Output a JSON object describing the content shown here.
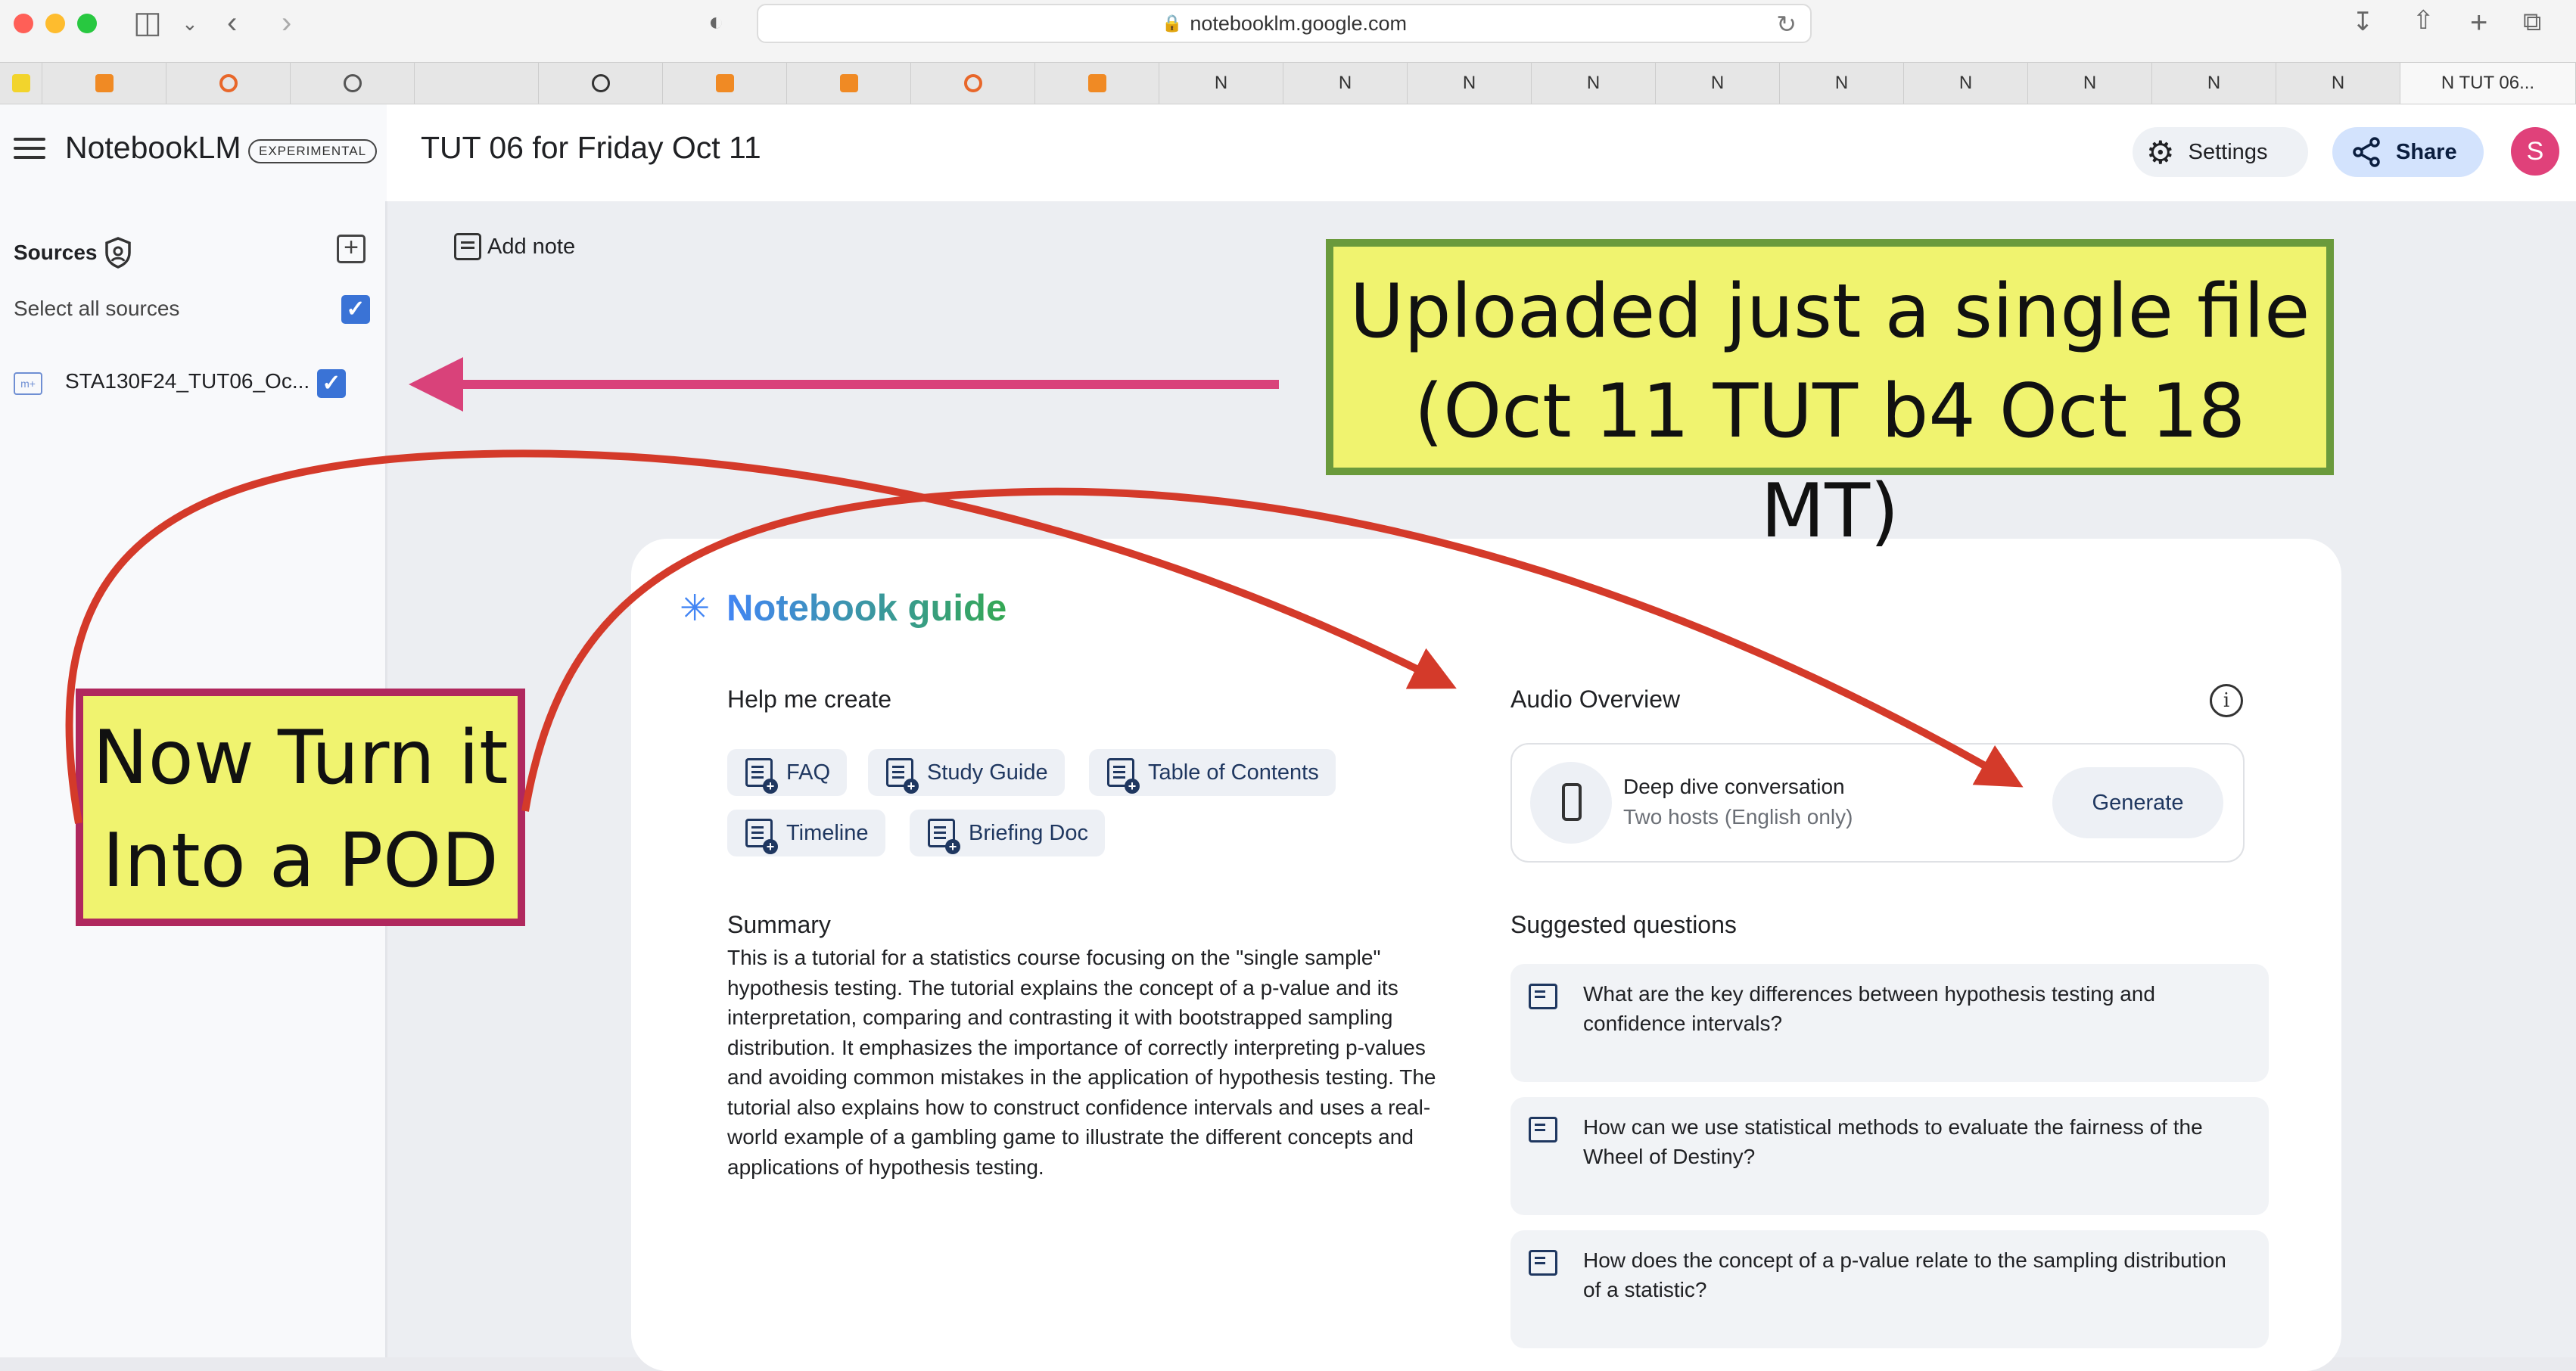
{
  "browser": {
    "url": "notebooklm.google.com",
    "tabs": [
      "",
      "",
      "",
      "",
      "",
      "",
      "",
      "",
      "",
      "N",
      "N",
      "N",
      "N",
      "N",
      "N",
      "N",
      "N",
      "N",
      "N",
      "N  TUT 06..."
    ],
    "active_tab_label": "N  TUT 06..."
  },
  "app": {
    "name": "NotebookLM",
    "badge": "EXPERIMENTAL",
    "notebook_title": "TUT 06 for Friday Oct 11",
    "settings_label": "Settings",
    "share_label": "Share",
    "avatar_initial": "S",
    "avatar_color": "#e0417a"
  },
  "sidebar": {
    "sources_label": "Sources",
    "select_all_label": "Select all sources",
    "sources": [
      {
        "label": "STA130F24_TUT06_Oc...",
        "checked": true
      }
    ]
  },
  "main": {
    "add_note_label": "Add note"
  },
  "guide": {
    "title": "Notebook guide",
    "help_heading": "Help me create",
    "chips": [
      "FAQ",
      "Study Guide",
      "Table of Contents",
      "Timeline",
      "Briefing Doc"
    ],
    "summary_heading": "Summary",
    "summary_text": "This is a tutorial for a statistics course focusing on the \"single sample\" hypothesis testing. The tutorial explains the concept of a p-value and its interpretation, comparing and contrasting it with bootstrapped sampling distribution. It emphasizes the importance of correctly interpreting p-values and avoiding common mistakes in the application of hypothesis testing. The tutorial also explains how to construct confidence intervals and uses a real-world example of a gambling game to illustrate the different concepts and applications of hypothesis testing.",
    "audio_heading": "Audio Overview",
    "audio_title": "Deep dive conversation",
    "audio_subtitle": "Two hosts (English only)",
    "generate_label": "Generate",
    "suggested_heading": "Suggested questions",
    "questions": [
      "What are the key differences between hypothesis testing and confidence intervals?",
      "How can we use statistical methods to evaluate the fairness of the Wheel of Destiny?",
      "How does the concept of a p-value relate to the sampling distribution of a statistic?"
    ]
  },
  "annotations": {
    "uploaded_line1": "Uploaded just a single file",
    "uploaded_line2": "(Oct 11 TUT b4 Oct 18 MT)",
    "pod_line1": "Now Turn it",
    "pod_line2": "Into a POD",
    "arrow_pink": "#d9427a",
    "arrow_red": "#d43a2a"
  }
}
